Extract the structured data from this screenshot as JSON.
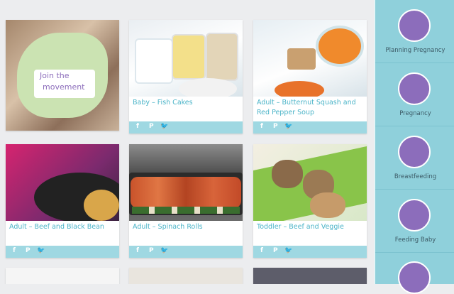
{
  "join_card": {
    "line1": "Join the",
    "line2": "movement"
  },
  "cards": [
    {
      "title": "Baby – Fish Cakes"
    },
    {
      "title": "Adult – Butternut Squash and Red Pepper Soup"
    },
    {
      "title": "Adult – Beef and Black Bean"
    },
    {
      "title": "Adult – Spinach Rolls"
    },
    {
      "title": "Toddler – Beef and Veggie"
    }
  ],
  "social": {
    "facebook": "f",
    "pinterest": "P",
    "twitter": "🐦"
  },
  "sidebar": {
    "items": [
      {
        "label": "Planning Pregnancy",
        "icon": "couple-icon"
      },
      {
        "label": "Pregnancy",
        "icon": "pregnant-icon"
      },
      {
        "label": "Breastfeeding",
        "icon": "breastfeeding-icon"
      },
      {
        "label": "Feeding Baby",
        "icon": "baby-icon"
      },
      {
        "label": "",
        "icon": "child-icon"
      }
    ]
  },
  "colors": {
    "accent": "#4bb4c8",
    "sidebar": "#8fd0db",
    "purple": "#8c6dbb",
    "social_bar": "#9fd8e2"
  }
}
